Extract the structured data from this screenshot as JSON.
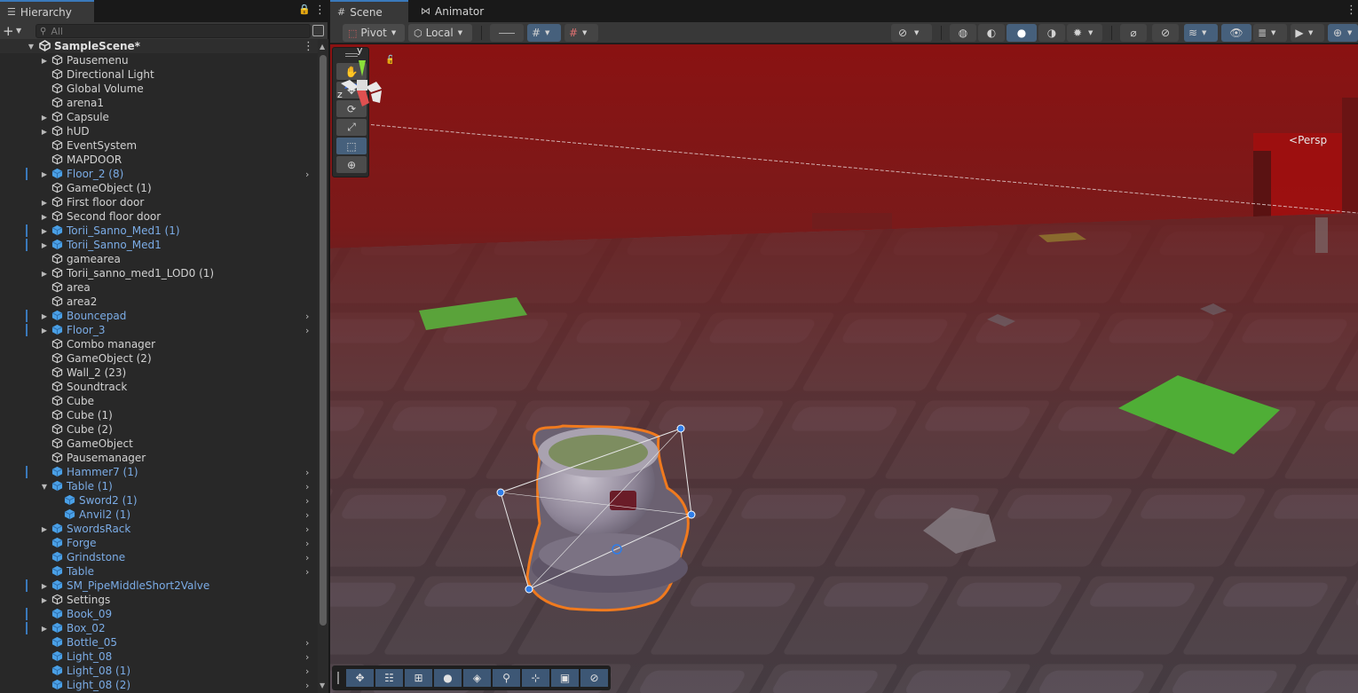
{
  "hierarchy": {
    "tab_label": "Hierarchy",
    "search_placeholder": "All",
    "scene_name": "SampleScene*",
    "items": [
      {
        "label": "Pausemenu",
        "depth": 0,
        "expand": "closed",
        "prefab": false,
        "marked": false,
        "chevron": false
      },
      {
        "label": "Directional Light",
        "depth": 0,
        "expand": "none",
        "prefab": false,
        "marked": false,
        "chevron": false
      },
      {
        "label": "Global Volume",
        "depth": 0,
        "expand": "none",
        "prefab": false,
        "marked": false,
        "chevron": false
      },
      {
        "label": "arena1",
        "depth": 0,
        "expand": "none",
        "prefab": false,
        "marked": false,
        "chevron": false
      },
      {
        "label": "Capsule",
        "depth": 0,
        "expand": "closed",
        "prefab": false,
        "marked": false,
        "chevron": false
      },
      {
        "label": "hUD",
        "depth": 0,
        "expand": "closed",
        "prefab": false,
        "marked": false,
        "chevron": false
      },
      {
        "label": "EventSystem",
        "depth": 0,
        "expand": "none",
        "prefab": false,
        "marked": false,
        "chevron": false
      },
      {
        "label": "MAPDOOR",
        "depth": 0,
        "expand": "none",
        "prefab": false,
        "marked": false,
        "chevron": false
      },
      {
        "label": "Floor_2 (8)",
        "depth": 0,
        "expand": "closed",
        "prefab": true,
        "marked": true,
        "chevron": true
      },
      {
        "label": "GameObject (1)",
        "depth": 0,
        "expand": "none",
        "prefab": false,
        "marked": false,
        "chevron": false
      },
      {
        "label": "First floor door",
        "depth": 0,
        "expand": "closed",
        "prefab": false,
        "marked": false,
        "chevron": false
      },
      {
        "label": "Second floor door",
        "depth": 0,
        "expand": "closed",
        "prefab": false,
        "marked": false,
        "chevron": false
      },
      {
        "label": "Torii_Sanno_Med1 (1)",
        "depth": 0,
        "expand": "closed",
        "prefab": true,
        "marked": true,
        "chevron": false
      },
      {
        "label": "Torii_Sanno_Med1",
        "depth": 0,
        "expand": "closed",
        "prefab": true,
        "marked": true,
        "chevron": false
      },
      {
        "label": "gamearea",
        "depth": 0,
        "expand": "none",
        "prefab": false,
        "marked": false,
        "chevron": false
      },
      {
        "label": "Torii_sanno_med1_LOD0 (1)",
        "depth": 0,
        "expand": "closed",
        "prefab": false,
        "marked": false,
        "chevron": false
      },
      {
        "label": "area",
        "depth": 0,
        "expand": "none",
        "prefab": false,
        "marked": false,
        "chevron": false
      },
      {
        "label": "area2",
        "depth": 0,
        "expand": "none",
        "prefab": false,
        "marked": false,
        "chevron": false
      },
      {
        "label": "Bouncepad",
        "depth": 0,
        "expand": "closed",
        "prefab": true,
        "marked": true,
        "chevron": true
      },
      {
        "label": "Floor_3",
        "depth": 0,
        "expand": "closed",
        "prefab": true,
        "marked": true,
        "chevron": true
      },
      {
        "label": "Combo manager",
        "depth": 0,
        "expand": "none",
        "prefab": false,
        "marked": false,
        "chevron": false
      },
      {
        "label": "GameObject (2)",
        "depth": 0,
        "expand": "none",
        "prefab": false,
        "marked": false,
        "chevron": false
      },
      {
        "label": "Wall_2 (23)",
        "depth": 0,
        "expand": "none",
        "prefab": false,
        "marked": false,
        "chevron": false
      },
      {
        "label": "Soundtrack",
        "depth": 0,
        "expand": "none",
        "prefab": false,
        "marked": false,
        "chevron": false
      },
      {
        "label": "Cube",
        "depth": 0,
        "expand": "none",
        "prefab": false,
        "marked": false,
        "chevron": false
      },
      {
        "label": "Cube (1)",
        "depth": 0,
        "expand": "none",
        "prefab": false,
        "marked": false,
        "chevron": false
      },
      {
        "label": "Cube (2)",
        "depth": 0,
        "expand": "none",
        "prefab": false,
        "marked": false,
        "chevron": false
      },
      {
        "label": "GameObject",
        "depth": 0,
        "expand": "none",
        "prefab": false,
        "marked": false,
        "chevron": false
      },
      {
        "label": "Pausemanager",
        "depth": 0,
        "expand": "none",
        "prefab": false,
        "marked": false,
        "chevron": false
      },
      {
        "label": "Hammer7 (1)",
        "depth": 0,
        "expand": "none",
        "prefab": true,
        "marked": true,
        "chevron": true
      },
      {
        "label": "Table (1)",
        "depth": 0,
        "expand": "open",
        "prefab": true,
        "marked": false,
        "chevron": true
      },
      {
        "label": "Sword2 (1)",
        "depth": 1,
        "expand": "none",
        "prefab": true,
        "marked": false,
        "chevron": true
      },
      {
        "label": "Anvil2 (1)",
        "depth": 1,
        "expand": "none",
        "prefab": true,
        "marked": false,
        "chevron": true
      },
      {
        "label": "SwordsRack",
        "depth": 0,
        "expand": "closed",
        "prefab": true,
        "marked": false,
        "chevron": true
      },
      {
        "label": "Forge",
        "depth": 0,
        "expand": "none",
        "prefab": true,
        "marked": false,
        "chevron": true
      },
      {
        "label": "Grindstone",
        "depth": 0,
        "expand": "none",
        "prefab": true,
        "marked": false,
        "chevron": true
      },
      {
        "label": "Table",
        "depth": 0,
        "expand": "none",
        "prefab": true,
        "marked": false,
        "chevron": true
      },
      {
        "label": "SM_PipeMiddleShort2Valve",
        "depth": 0,
        "expand": "closed",
        "prefab": true,
        "marked": true,
        "chevron": false
      },
      {
        "label": "Settings",
        "depth": 0,
        "expand": "closed",
        "prefab": false,
        "marked": false,
        "chevron": false
      },
      {
        "label": "Book_09",
        "depth": 0,
        "expand": "none",
        "prefab": true,
        "marked": true,
        "chevron": false
      },
      {
        "label": "Box_02",
        "depth": 0,
        "expand": "closed",
        "prefab": true,
        "marked": true,
        "chevron": false
      },
      {
        "label": "Bottle_05",
        "depth": 0,
        "expand": "none",
        "prefab": true,
        "marked": false,
        "chevron": true
      },
      {
        "label": "Light_08",
        "depth": 0,
        "expand": "none",
        "prefab": true,
        "marked": false,
        "chevron": true
      },
      {
        "label": "Light_08 (1)",
        "depth": 0,
        "expand": "none",
        "prefab": true,
        "marked": false,
        "chevron": true
      },
      {
        "label": "Light_08 (2)",
        "depth": 0,
        "expand": "none",
        "prefab": true,
        "marked": false,
        "chevron": true
      }
    ]
  },
  "scene_tabs": {
    "scene_label": "Scene",
    "animator_label": "Animator"
  },
  "toolbar": {
    "pivot_label": "Pivot",
    "local_label": "Local"
  },
  "tools": [
    {
      "name": "view-tool-button",
      "icon": "hand-icon",
      "glyph": "✋",
      "selected": false
    },
    {
      "name": "move-tool-button",
      "icon": "move-icon",
      "glyph": "✥",
      "selected": false
    },
    {
      "name": "rotate-tool-button",
      "icon": "rotate-icon",
      "glyph": "⟳",
      "selected": false
    },
    {
      "name": "scale-tool-button",
      "icon": "scale-icon",
      "glyph": "⤢",
      "selected": false
    },
    {
      "name": "rect-tool-button",
      "icon": "rect-icon",
      "glyph": "⬚",
      "selected": true
    },
    {
      "name": "transform-tool-button",
      "icon": "transform-icon",
      "glyph": "⊕",
      "selected": false
    }
  ],
  "gizmo": {
    "y_label": "y",
    "z_label": "z",
    "persp_label": "Persp"
  },
  "colors": {
    "accent": "#3a79bb",
    "prefab_text": "#7bace6",
    "selection_outline": "#f07a1e",
    "scene_tint": "#8a1212"
  }
}
